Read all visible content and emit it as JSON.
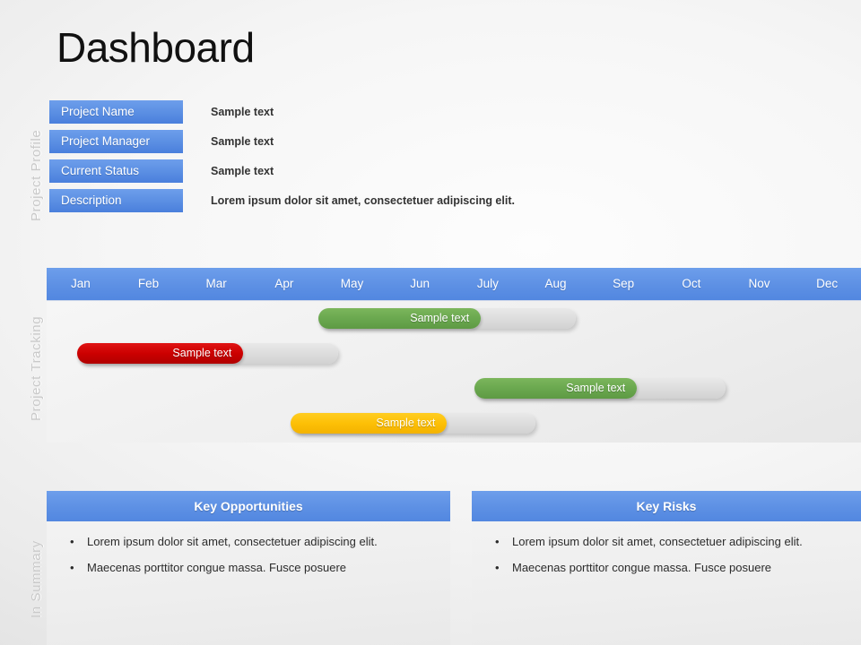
{
  "slide": {
    "title": "Dashboard",
    "background_color": "#f0f0f0",
    "accent_color": "#6d9eeb"
  },
  "section_labels": {
    "profile": "Project Profile",
    "tracking": "Project Tracking",
    "summary": "In Summary"
  },
  "profile": {
    "rows": [
      {
        "key": "Project Name",
        "value": "Sample text"
      },
      {
        "key": "Project Manager",
        "value": "Sample text"
      },
      {
        "key": "Current Status",
        "value": "Sample text"
      },
      {
        "key": "Description",
        "value": "Lorem ipsum dolor sit amet, consectetuer adipiscing elit."
      }
    ]
  },
  "tracking": {
    "months": [
      "Jan",
      "Feb",
      "Mar",
      "Apr",
      "May",
      "Jun",
      "July",
      "Aug",
      "Sep",
      "Oct",
      "Nov",
      "Dec"
    ],
    "bars": [
      {
        "label": "Sample text",
        "color": "#6aa84f",
        "color_name": "green",
        "start_month": 4.0,
        "fill_end_month": 6.4,
        "track_end_month": 7.8
      },
      {
        "label": "Sample text",
        "color": "#cc0000",
        "color_name": "red",
        "start_month": 0.45,
        "fill_end_month": 2.9,
        "track_end_month": 4.3
      },
      {
        "label": "Sample text",
        "color": "#6aa84f",
        "color_name": "green",
        "start_month": 6.3,
        "fill_end_month": 8.7,
        "track_end_month": 10.0
      },
      {
        "label": "Sample text",
        "color": "#ffc000",
        "color_name": "orange",
        "start_month": 3.6,
        "fill_end_month": 5.9,
        "track_end_month": 7.2
      }
    ]
  },
  "summary": {
    "panels": [
      {
        "heading": "Key Opportunities",
        "bullets": [
          "Lorem ipsum dolor sit amet, consectetuer adipiscing elit.",
          "Maecenas porttitor congue massa. Fusce posuere"
        ]
      },
      {
        "heading": "Key Risks",
        "bullets": [
          "Lorem ipsum dolor sit amet, consectetuer adipiscing elit.",
          "Maecenas porttitor congue massa. Fusce posuere"
        ]
      }
    ],
    "bullet_glyph": "•"
  }
}
